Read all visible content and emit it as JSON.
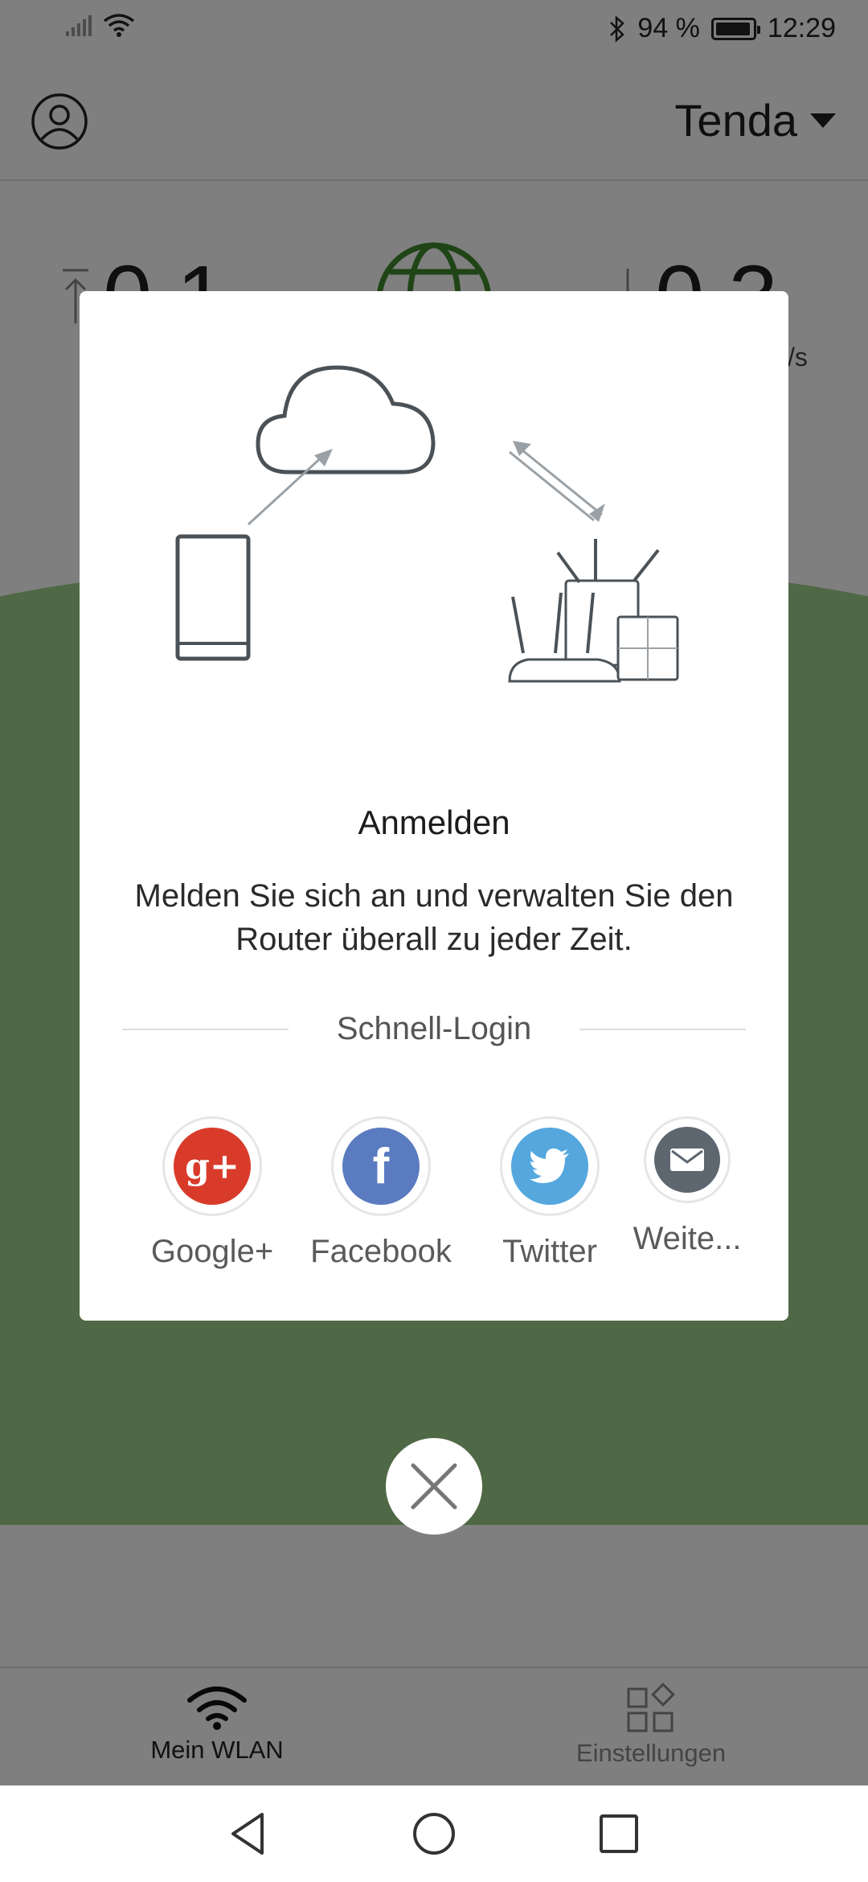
{
  "status_bar": {
    "battery_percent": "94 %",
    "time": "12:29",
    "icons": [
      "signal-icon",
      "wifi-icon",
      "bluetooth-icon",
      "battery-icon"
    ]
  },
  "app_bar": {
    "device_name": "Tenda",
    "icons": [
      "account-icon",
      "dropdown-caret-icon"
    ]
  },
  "background_stats": {
    "upload_value": "0.1",
    "download_value": "0.3",
    "unit_partial": "/s"
  },
  "dialog": {
    "title": "Anmelden",
    "description": "Melden Sie sich an und verwalten Sie den Router überall zu jeder Zeit.",
    "quick_login_label": "Schnell-Login",
    "social_options": [
      {
        "label": "Google+",
        "icon": "google-plus-icon",
        "color": "#d93b2b"
      },
      {
        "label": "Facebook",
        "icon": "facebook-icon",
        "color": "#5b7bc0"
      },
      {
        "label": "Twitter",
        "icon": "twitter-icon",
        "color": "#55a7de"
      },
      {
        "label": "Weite...",
        "icon": "mail-icon",
        "color": "#5e6770"
      }
    ]
  },
  "bottom_nav": {
    "items": [
      {
        "label": "Mein WLAN",
        "icon": "wifi-icon"
      },
      {
        "label": "Einstellungen",
        "icon": "settings-grid-icon"
      }
    ]
  },
  "colors": {
    "overlay": "rgba(0,0,0,0.5)",
    "green_background": "#9ed08a"
  }
}
